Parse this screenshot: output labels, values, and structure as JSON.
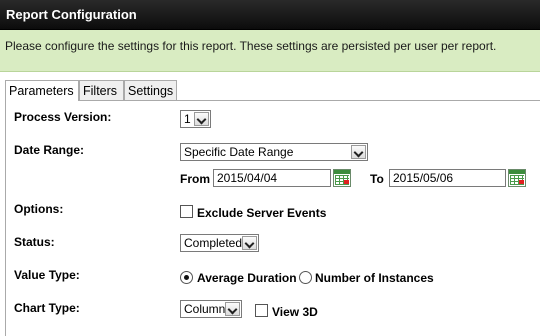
{
  "window": {
    "title": "Report Configuration"
  },
  "notice": "Please configure the settings for this report. These settings are persisted per user per report.",
  "tabs": [
    {
      "label": "Parameters",
      "active": true
    },
    {
      "label": "Filters",
      "active": false
    },
    {
      "label": "Settings",
      "active": false
    }
  ],
  "form": {
    "process_version": {
      "label": "Process Version:",
      "value": "1"
    },
    "date_range": {
      "label": "Date Range:",
      "value": "Specific Date Range",
      "from_label": "From",
      "from_value": "2015/04/04",
      "to_label": "To",
      "to_value": "2015/05/06"
    },
    "options": {
      "label": "Options:",
      "exclude_server_events": "Exclude Server Events",
      "checked": false
    },
    "status": {
      "label": "Status:",
      "value": "Completed"
    },
    "value_type": {
      "label": "Value Type:",
      "option1": "Average Duration",
      "option2": "Number of Instances",
      "selected": "Average Duration"
    },
    "chart_type": {
      "label": "Chart Type:",
      "value": "Column",
      "view3d_label": "View 3D",
      "view3d_checked": false
    }
  },
  "icons": {
    "calendar": "calendar-icon",
    "dropdown": "chevron-down-icon"
  }
}
